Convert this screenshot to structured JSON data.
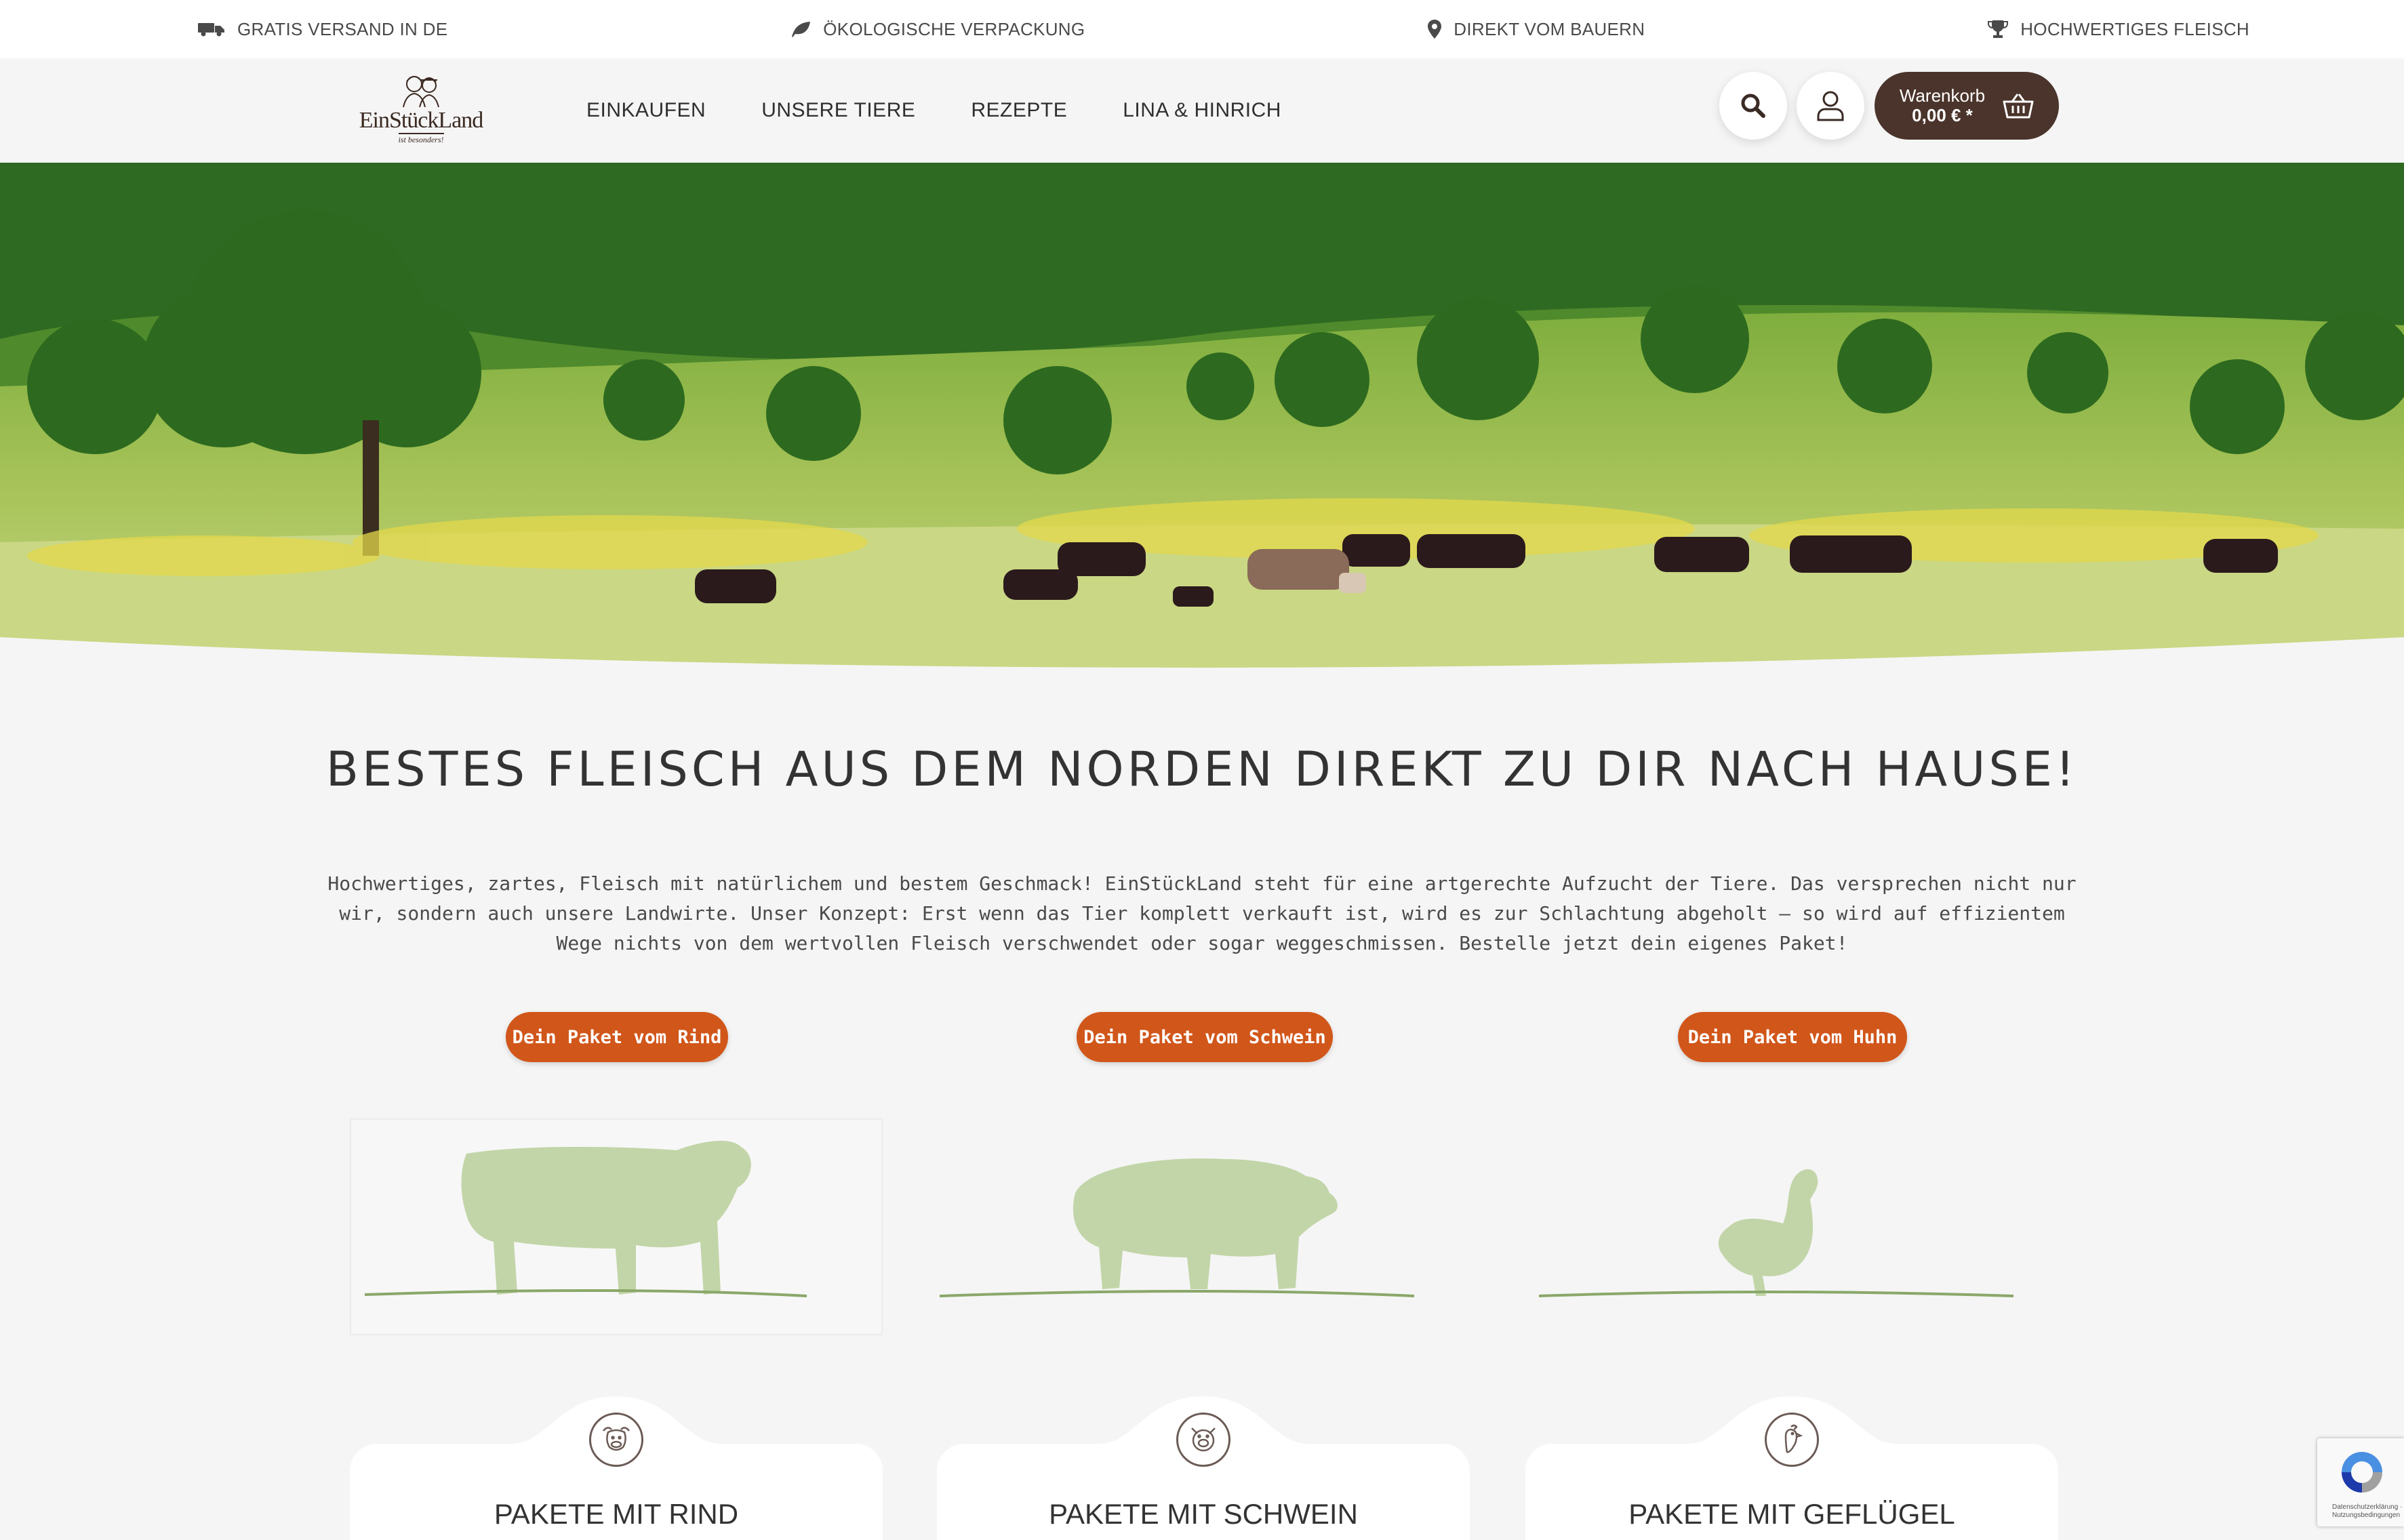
{
  "usp_bar": {
    "items": [
      {
        "icon": "truck-icon",
        "label": "GRATIS VERSAND IN DE"
      },
      {
        "icon": "leaf-icon",
        "label": "ÖKOLOGISCHE VERPACKUNG"
      },
      {
        "icon": "map-pin-icon",
        "label": "DIREKT VOM BAUERN"
      },
      {
        "icon": "trophy-icon",
        "label": "HOCHWERTIGES FLEISCH"
      }
    ]
  },
  "header": {
    "logo": {
      "text": "EinStückLand",
      "subtext": "ist besonders!"
    },
    "nav": [
      {
        "label": "EINKAUFEN"
      },
      {
        "label": "UNSERE TIERE"
      },
      {
        "label": "REZEPTE"
      },
      {
        "label": "LINA & HINRICH"
      }
    ],
    "cart": {
      "label": "Warenkorb",
      "total": "0,00 € *"
    }
  },
  "intro": {
    "headline": "BESTES FLEISCH AUS DEM NORDEN DIREKT ZU DIR NACH HAUSE!",
    "text": "Hochwertiges, zartes, Fleisch mit natürlichem und bestem Geschmack! EinStückLand steht für eine artgerechte Aufzucht der Tiere. Das versprechen nicht nur wir, sondern auch unsere Landwirte. Unser Konzept: Erst wenn das Tier komplett verkauft ist, wird es zur Schlachtung abgeholt – so wird auf effizientem Wege nichts von dem wertvollen Fleisch verschwendet oder sogar weggeschmissen. Bestelle jetzt dein eigenes Paket!"
  },
  "packages": {
    "rind_button": "Dein Paket vom Rind",
    "schwein_button": "Dein Paket vom Schwein",
    "huhn_button": "Dein Paket vom Huhn"
  },
  "categories": [
    {
      "title": "PAKETE MIT RIND",
      "icon": "cow-head-icon"
    },
    {
      "title": "PAKETE MIT SCHWEIN",
      "icon": "pig-head-icon"
    },
    {
      "title": "PAKETE MIT GEFLÜGEL",
      "icon": "chicken-head-icon"
    }
  ],
  "recaptcha": {
    "links": "Datenschutzerklärung · Nutzungsbedingungen"
  },
  "colors": {
    "accent": "#d1561a",
    "cart_bg": "#4a342b",
    "background": "#f5f5f5",
    "illustration": "#b9cf9a"
  }
}
